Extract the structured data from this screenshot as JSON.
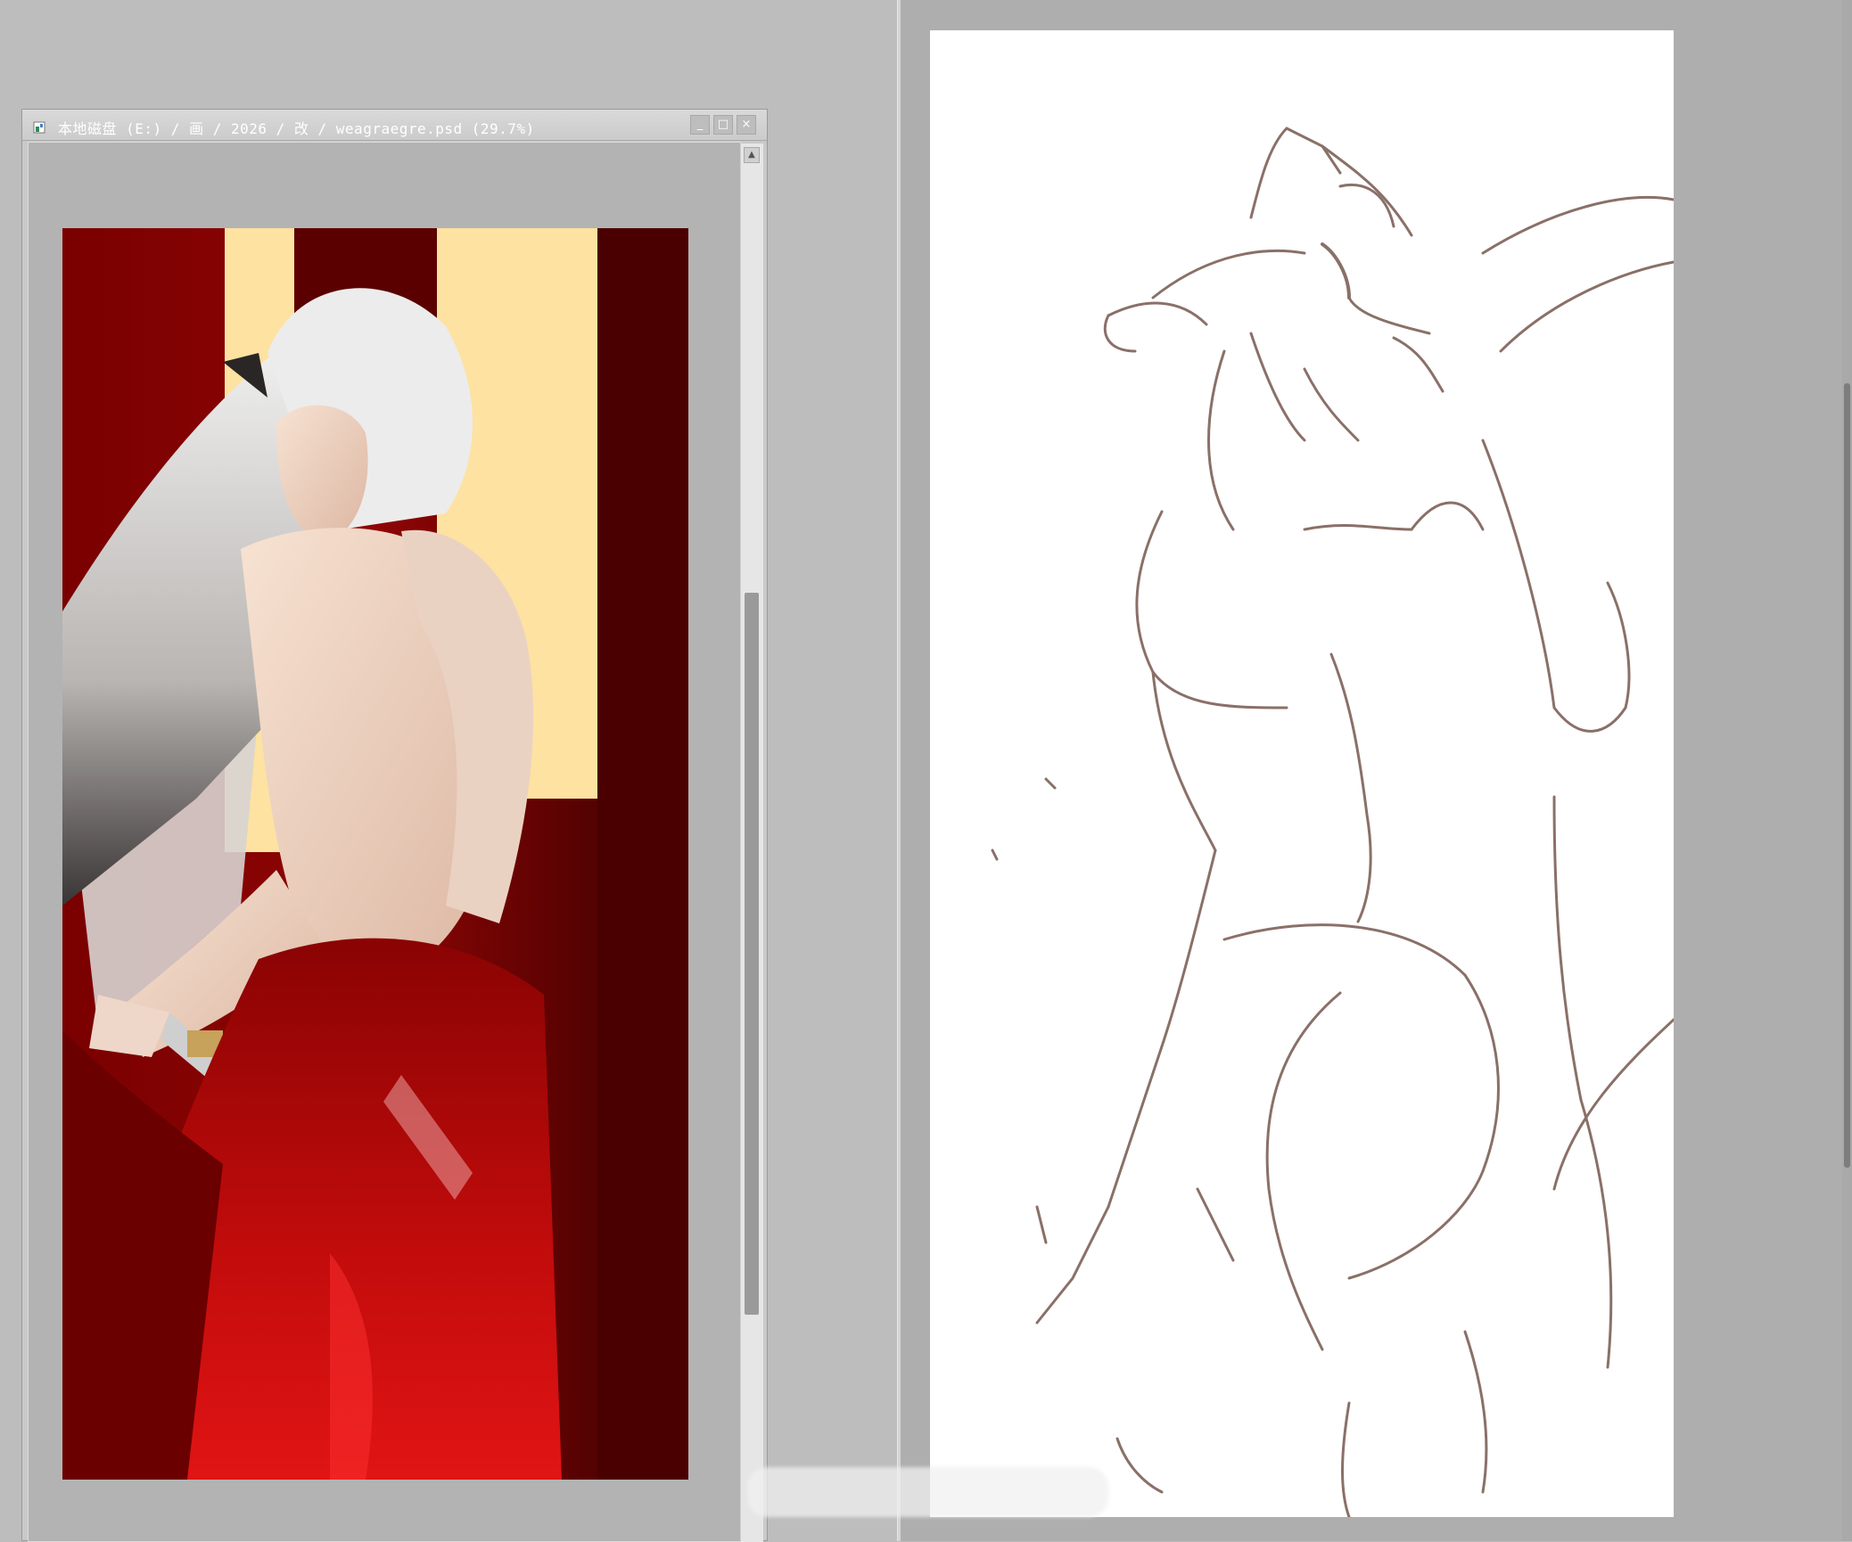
{
  "left_window": {
    "title": "本地磁盘 (E:) / 画 / 2026 / 改 / weagraegre.psd (29.7%)",
    "controls": {
      "minimize": "_",
      "maximize": "□",
      "close": "×"
    },
    "scroll_up_glyph": "▲",
    "icons": {
      "app": "document-icon"
    }
  },
  "colors": {
    "painting_red": "#7a0000",
    "painting_bright_red": "#d10a0a",
    "painting_cream": "#fde2a1",
    "sketch_stroke": "#8a7068",
    "workspace_left": "#bdbdbd",
    "workspace_right": "#aeaeae"
  }
}
